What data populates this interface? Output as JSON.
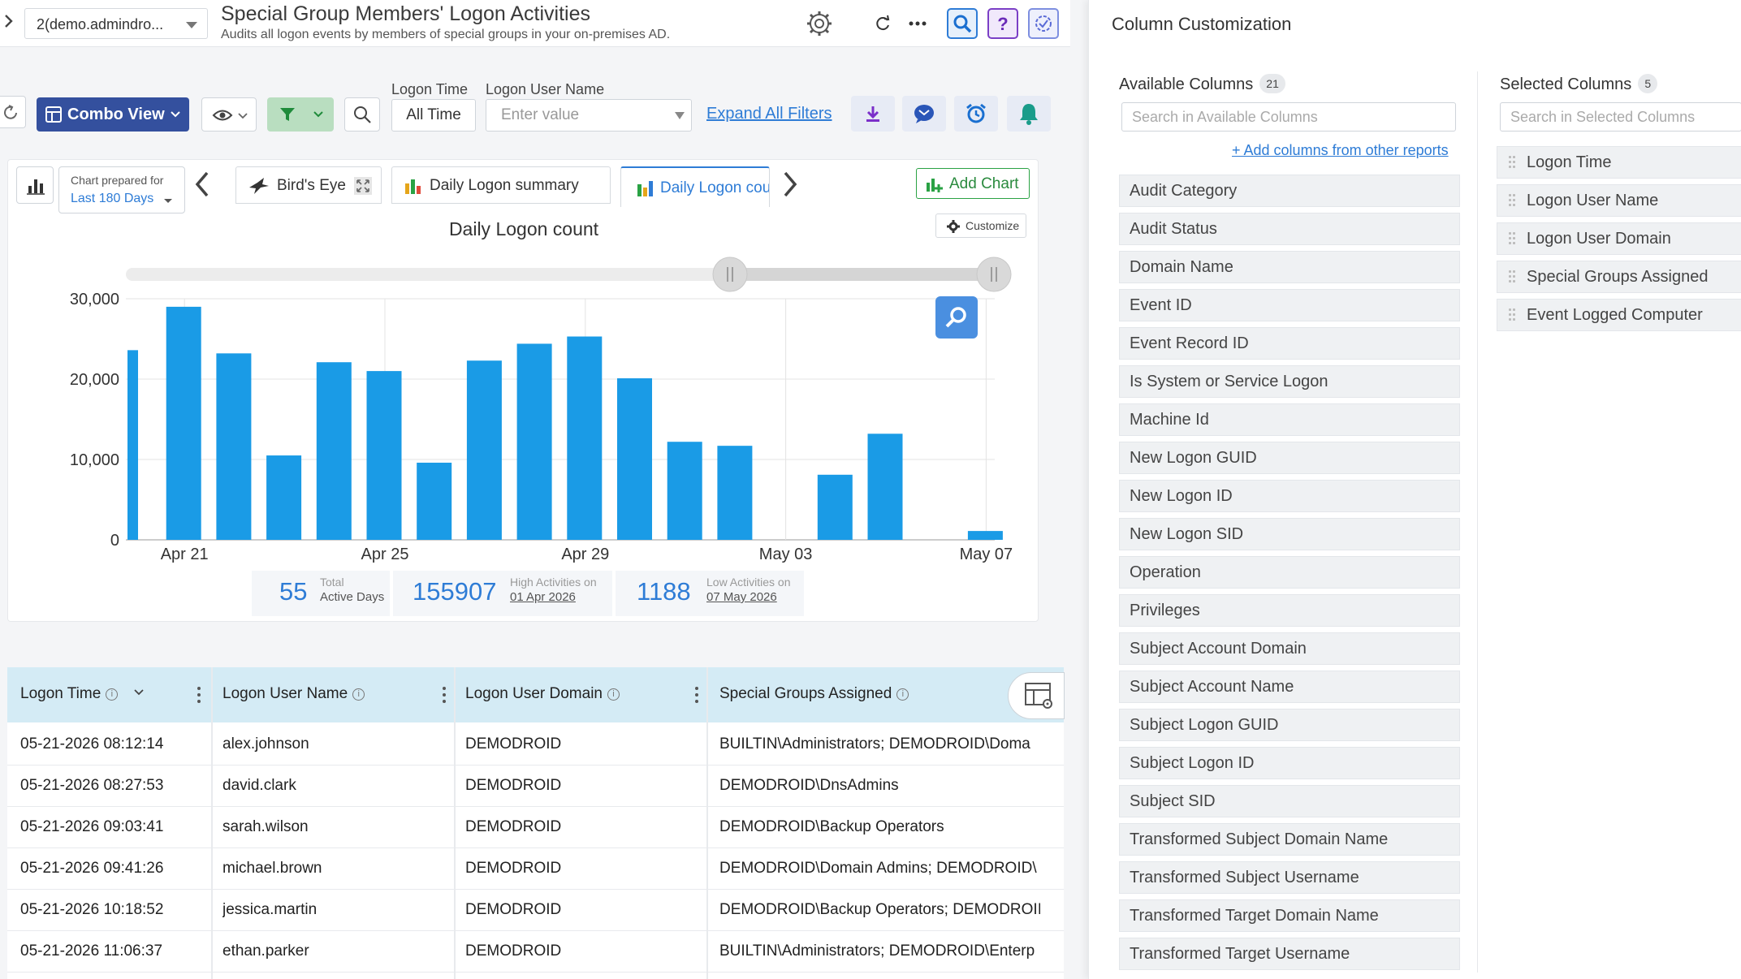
{
  "header": {
    "domain_select": "2(demo.admindro...",
    "title": "Special Group Members' Logon Activities",
    "subtitle": "Audits all logon events by members of special groups in your on-premises AD."
  },
  "toolbar": {
    "combo_view": "Combo View",
    "logon_time_label": "Logon Time",
    "logon_time_value": "All Time",
    "logon_user_label": "Logon User Name",
    "logon_user_placeholder": "Enter value",
    "expand_filters": "Expand All Filters"
  },
  "chart_panel": {
    "prepared_for_label": "Chart prepared for",
    "prepared_for_value": "Last 180 Days",
    "tabs": [
      {
        "label": "Bird's Eye"
      },
      {
        "label": "Daily Logon summary"
      },
      {
        "label": "Daily Logon cou"
      }
    ],
    "add_chart": "Add Chart",
    "customize": "Customize",
    "kpis": [
      {
        "value": "55",
        "label1": "Total",
        "label2": "Active Days"
      },
      {
        "value": "155907",
        "label1": "High Activities on",
        "label2": "01 Apr 2026"
      },
      {
        "value": "1188",
        "label1": "Low Activities on",
        "label2": "07 May 2026"
      }
    ]
  },
  "chart_data": {
    "type": "bar",
    "title": "Daily Logon count",
    "xlabel": "",
    "ylabel": "",
    "ylim": [
      0,
      30000
    ],
    "yticks": [
      "0",
      "10,000",
      "20,000",
      "30,000"
    ],
    "xticks": [
      "Apr 21",
      "Apr 25",
      "Apr 29",
      "May 03",
      "May 07"
    ],
    "categories": [
      "Apr 20",
      "Apr 21",
      "Apr 22",
      "Apr 23",
      "Apr 24",
      "Apr 25",
      "Apr 26",
      "Apr 27",
      "Apr 28",
      "Apr 29",
      "Apr 30",
      "May 01",
      "May 02",
      "May 03",
      "May 04",
      "May 05",
      "May 06",
      "May 07"
    ],
    "values": [
      23600,
      29000,
      23200,
      10500,
      22100,
      21000,
      9600,
      22300,
      24400,
      25300,
      20100,
      12200,
      11700,
      0,
      8100,
      13200,
      0,
      1100
    ],
    "grid": true,
    "color": "#1a9be6"
  },
  "table": {
    "columns": [
      "Logon Time",
      "Logon User Name",
      "Logon User Domain",
      "Special Groups Assigned"
    ],
    "rows": [
      [
        "05-21-2026 08:12:14",
        "alex.johnson",
        "DEMODROID",
        "BUILTIN\\Administrators; DEMODROID\\Doma"
      ],
      [
        "05-21-2026 08:27:53",
        "david.clark",
        "DEMODROID",
        "DEMODROID\\DnsAdmins"
      ],
      [
        "05-21-2026 09:03:41",
        "sarah.wilson",
        "DEMODROID",
        "DEMODROID\\Backup Operators"
      ],
      [
        "05-21-2026 09:41:26",
        "michael.brown",
        "DEMODROID",
        "DEMODROID\\Domain Admins; DEMODROID\\"
      ],
      [
        "05-21-2026 10:18:52",
        "jessica.martin",
        "DEMODROID",
        "DEMODROID\\Backup Operators; DEMODROII"
      ],
      [
        "05-21-2026 11:06:37",
        "ethan.parker",
        "DEMODROID",
        "BUILTIN\\Administrators; DEMODROID\\Enterp"
      ]
    ]
  },
  "column_customization": {
    "title": "Column Customization",
    "available_title": "Available Columns",
    "available_count": "21",
    "available_search_placeholder": "Search in Available Columns",
    "add_columns_link": "+ Add columns from other reports",
    "available": [
      "Audit Category",
      "Audit Status",
      "Domain Name",
      "Event ID",
      "Event Record ID",
      "Is System or Service Logon",
      "Machine Id",
      "New Logon GUID",
      "New Logon ID",
      "New Logon SID",
      "Operation",
      "Privileges",
      "Subject Account Domain",
      "Subject Account Name",
      "Subject Logon GUID",
      "Subject Logon ID",
      "Subject SID",
      "Transformed Subject Domain Name",
      "Transformed Subject Username",
      "Transformed Target Domain Name",
      "Transformed Target Username"
    ],
    "selected_title": "Selected Columns",
    "selected_count": "5",
    "selected_search_placeholder": "Search in Selected Columns",
    "selected": [
      "Logon Time",
      "Logon User Name",
      "Logon User Domain",
      "Special Groups Assigned",
      "Event Logged Computer"
    ]
  }
}
